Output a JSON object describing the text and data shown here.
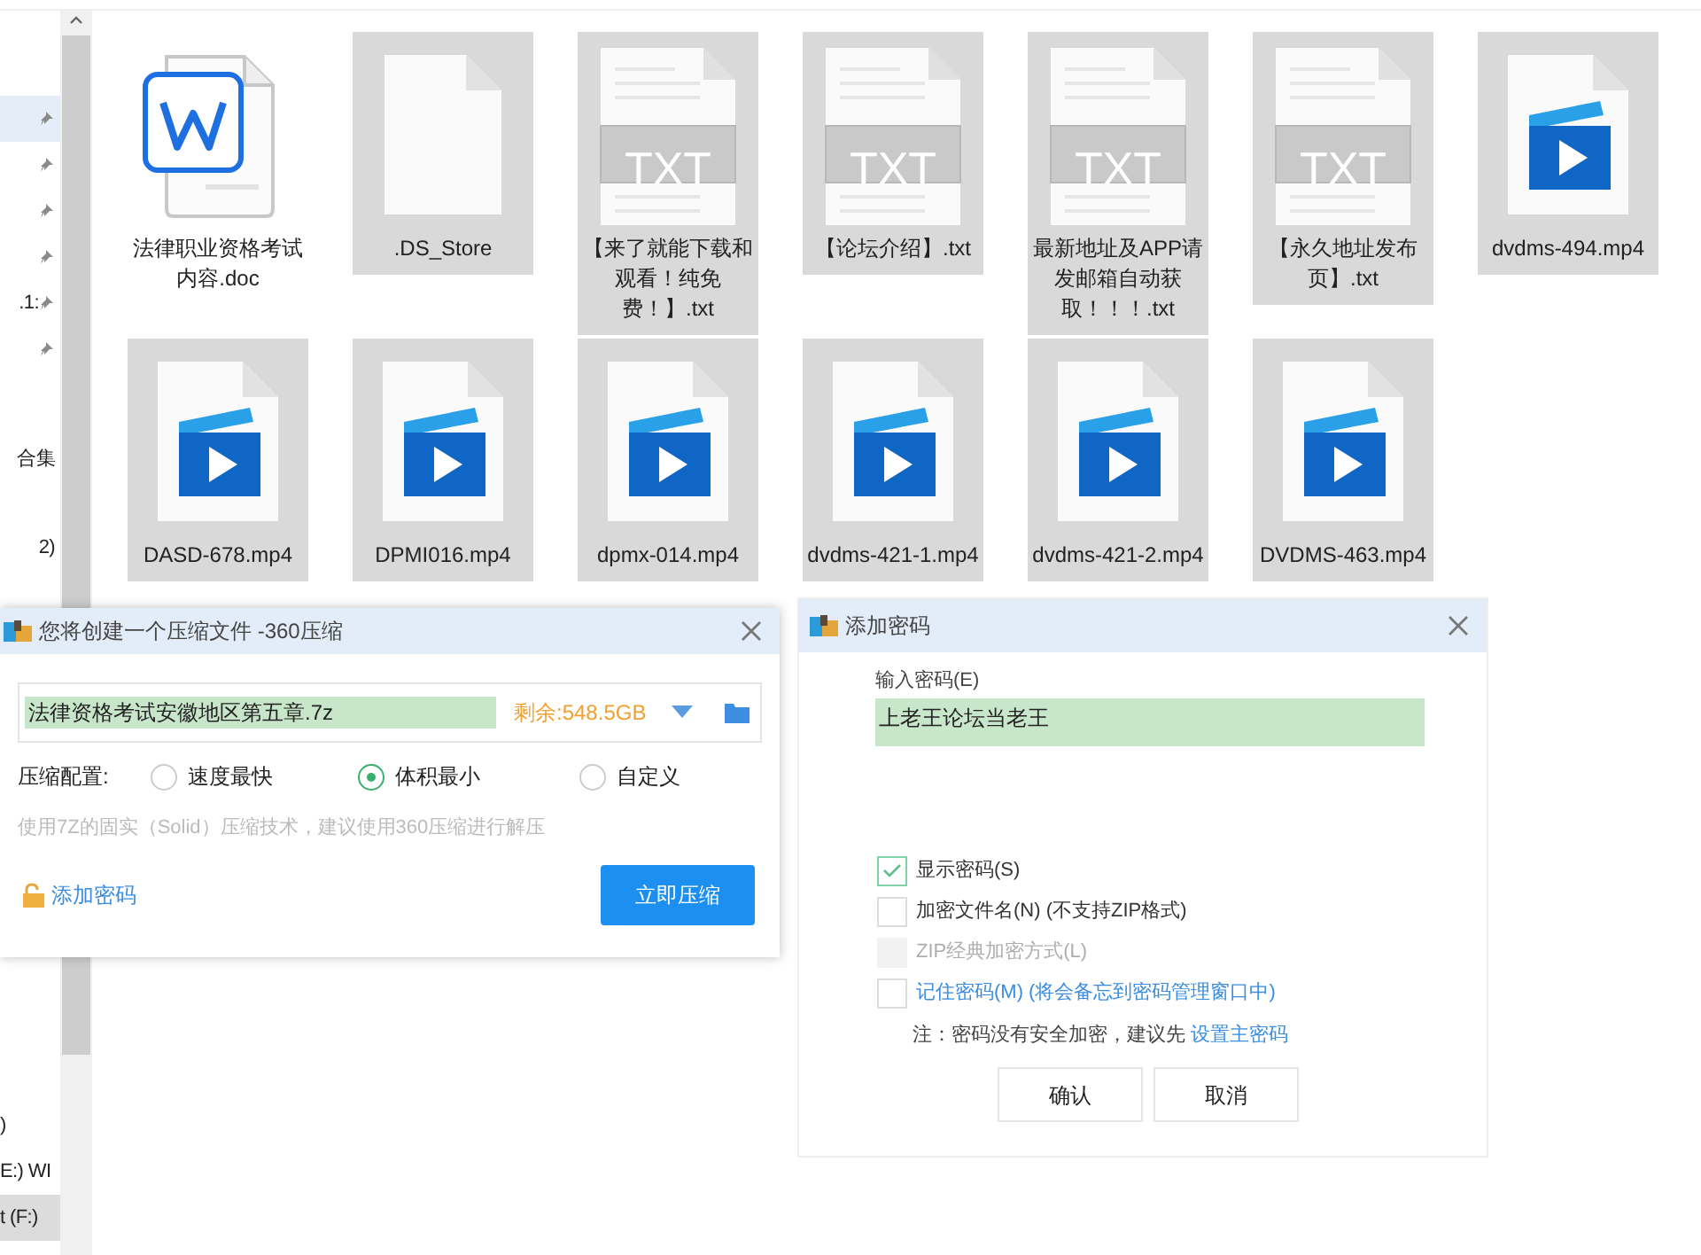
{
  "sidebar": {
    "groups": [
      {
        "items": [
          {
            "pinned": true,
            "selected": true
          },
          {
            "pinned": true,
            "selected": false
          },
          {
            "pinned": true,
            "selected": false
          },
          {
            "pinned": true,
            "selected": false
          },
          {
            "label": ".1:",
            "pinned": true,
            "selected": false
          },
          {
            "pinned": true,
            "selected": false
          }
        ]
      },
      {
        "items": [
          {
            "label": "合集",
            "pinned": false,
            "selected": false
          },
          {
            "label": "2)",
            "pinned": false,
            "selected": false
          }
        ]
      },
      {
        "items": [
          {
            "label": ")",
            "pinned": false,
            "selected": false
          },
          {
            "label": "E:) WI",
            "pinned": false,
            "selected": false
          },
          {
            "label": "t (F:)",
            "pinned": false,
            "selected": true
          }
        ]
      }
    ]
  },
  "files": [
    {
      "name": "法律职业资格考试内容.doc",
      "kind": "doc",
      "selected": false
    },
    {
      "name": ".DS_Store",
      "kind": "blank",
      "selected": true
    },
    {
      "name": "【来了就能下载和观看！纯免费！】.txt",
      "kind": "txt",
      "icon_text": "TXT",
      "selected": true
    },
    {
      "name": "【论坛介绍】.txt",
      "kind": "txt",
      "icon_text": "TXT",
      "selected": true
    },
    {
      "name": "最新地址及APP请发邮箱自动获取！！！.txt",
      "kind": "txt",
      "icon_text": "TXT",
      "selected": true
    },
    {
      "name": "【永久地址发布页】.txt",
      "kind": "txt",
      "icon_text": "TXT",
      "selected": true
    },
    {
      "name": "dvdms-494.mp4",
      "kind": "video",
      "selected": true
    },
    {
      "name": "DASD-678.mp4",
      "kind": "video",
      "selected": true
    },
    {
      "name": "DPMI016.mp4",
      "kind": "video",
      "selected": true
    },
    {
      "name": "dpmx-014.mp4",
      "kind": "video",
      "selected": true
    },
    {
      "name": "dvdms-421-1.mp4",
      "kind": "video",
      "selected": true
    },
    {
      "name": "dvdms-421-2.mp4",
      "kind": "video",
      "selected": true
    },
    {
      "name": "DVDMS-463.mp4",
      "kind": "video",
      "selected": true
    }
  ],
  "compress_dialog": {
    "title": "您将创建一个压缩文件 -360压缩",
    "filename": "法律资格考试安徽地区第五章.7z",
    "free_space": "剩余:548.5GB",
    "config_label": "压缩配置:",
    "options": [
      {
        "label": "速度最快",
        "selected": false
      },
      {
        "label": "体积最小",
        "selected": true
      },
      {
        "label": "自定义",
        "selected": false
      }
    ],
    "hint": "使用7Z的固实（Solid）压缩技术，建议使用360压缩进行解压",
    "password_link": "添加密码",
    "submit": "立即压缩"
  },
  "password_dialog": {
    "title": "添加密码",
    "field_label": "输入密码(E)",
    "password": "上老王论坛当老王",
    "checkboxes": [
      {
        "label": "显示密码(S)",
        "checked": true,
        "disabled": false,
        "kind": "plain"
      },
      {
        "label": "加密文件名(N) (不支持ZIP格式)",
        "checked": false,
        "disabled": false,
        "kind": "plain"
      },
      {
        "label": "ZIP经典加密方式(L)",
        "checked": false,
        "disabled": true,
        "kind": "plain"
      },
      {
        "label": "记住密码(M) (将会备忘到密码管理窗口中)",
        "checked": false,
        "disabled": false,
        "kind": "link"
      }
    ],
    "note": "注：密码没有安全加密，建议先",
    "note_link": "设置主密码",
    "buttons": [
      "确认",
      "取消"
    ]
  }
}
